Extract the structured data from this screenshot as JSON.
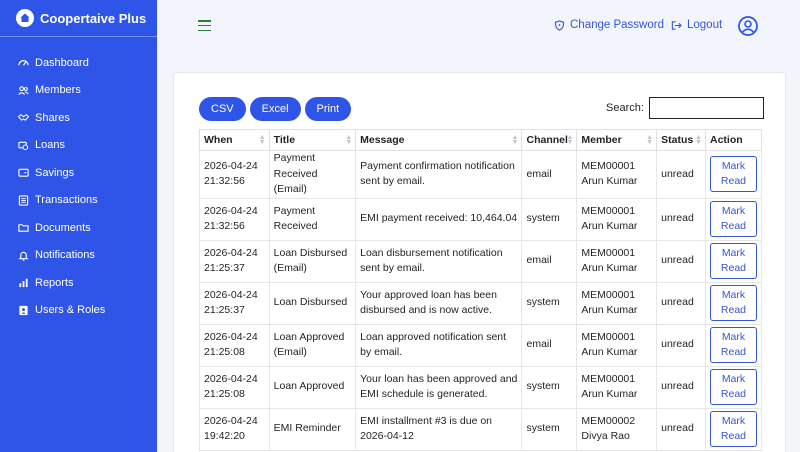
{
  "app": {
    "title": "Coopertaive Plus"
  },
  "sidebar": {
    "items": [
      {
        "label": "Dashboard",
        "icon": "dashboard-icon"
      },
      {
        "label": "Members",
        "icon": "users-icon"
      },
      {
        "label": "Shares",
        "icon": "handshake-icon"
      },
      {
        "label": "Loans",
        "icon": "money-icon"
      },
      {
        "label": "Savings",
        "icon": "wallet-icon"
      },
      {
        "label": "Transactions",
        "icon": "list-icon"
      },
      {
        "label": "Documents",
        "icon": "folder-icon"
      },
      {
        "label": "Notifications",
        "icon": "bell-icon"
      },
      {
        "label": "Reports",
        "icon": "chart-icon"
      },
      {
        "label": "Users & Roles",
        "icon": "user-shield-icon"
      }
    ]
  },
  "header": {
    "change_password": "Change Password",
    "logout": "Logout"
  },
  "toolbar": {
    "csv": "CSV",
    "excel": "Excel",
    "print": "Print",
    "search_label": "Search:",
    "search_value": ""
  },
  "table": {
    "columns": [
      "When",
      "Title",
      "Message",
      "Channel",
      "Member",
      "Status",
      "Action"
    ],
    "rows": [
      {
        "date": "2026-04-24",
        "time": "21:32:56",
        "title": "Payment Received (Email)",
        "message": "Payment confirmation notification sent by email.",
        "channel": "email",
        "member": "MEM00001 Arun Kumar",
        "status": "unread",
        "action": "Mark Read"
      },
      {
        "date": "2026-04-24",
        "time": "21:32:56",
        "title": "Payment Received",
        "message": "EMI payment received: 10,464.04",
        "channel": "system",
        "member": "MEM00001 Arun Kumar",
        "status": "unread",
        "action": "Mark Read"
      },
      {
        "date": "2026-04-24",
        "time": "21:25:37",
        "title": "Loan Disbursed (Email)",
        "message": "Loan disbursement notification sent by email.",
        "channel": "email",
        "member": "MEM00001 Arun Kumar",
        "status": "unread",
        "action": "Mark Read"
      },
      {
        "date": "2026-04-24",
        "time": "21:25:37",
        "title": "Loan Disbursed",
        "message": "Your approved loan has been disbursed and is now active.",
        "channel": "system",
        "member": "MEM00001 Arun Kumar",
        "status": "unread",
        "action": "Mark Read"
      },
      {
        "date": "2026-04-24",
        "time": "21:25:08",
        "title": "Loan Approved (Email)",
        "message": "Loan approved notification sent by email.",
        "channel": "email",
        "member": "MEM00001 Arun Kumar",
        "status": "unread",
        "action": "Mark Read"
      },
      {
        "date": "2026-04-24",
        "time": "21:25:08",
        "title": "Loan Approved",
        "message": "Your loan has been approved and EMI schedule is generated.",
        "channel": "system",
        "member": "MEM00001 Arun Kumar",
        "status": "unread",
        "action": "Mark Read"
      },
      {
        "date": "2026-04-24",
        "time": "19:42:20",
        "title": "EMI Reminder",
        "message": "EMI installment #3 is due on 2026-04-12",
        "channel": "system",
        "member": "MEM00002 Divya Rao",
        "status": "unread",
        "action": "Mark Read"
      }
    ]
  }
}
